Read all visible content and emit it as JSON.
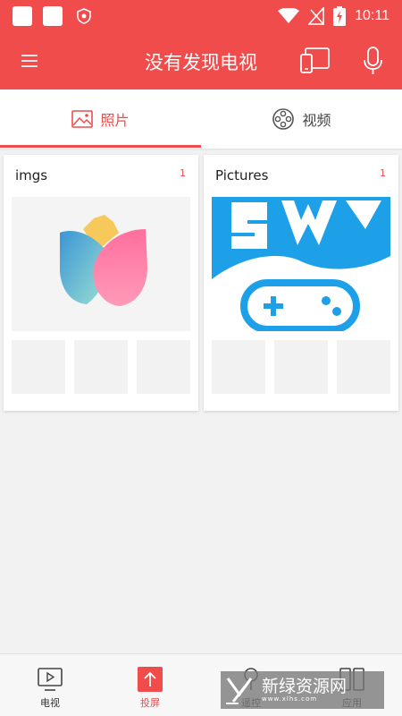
{
  "status_bar": {
    "time": "10:11",
    "icons": [
      "notification-square-icon",
      "notification-square-icon",
      "shield-icon",
      "wifi-icon",
      "no-signal-icon",
      "battery-charging-icon"
    ]
  },
  "app_bar": {
    "title": "没有发现电视",
    "icons": [
      "menu-icon",
      "tv-connect-icon",
      "microphone-icon"
    ]
  },
  "tabs": [
    {
      "label": "照片",
      "icon": "image-icon",
      "active": true
    },
    {
      "label": "视频",
      "icon": "film-reel-icon",
      "active": false
    }
  ],
  "albums": [
    {
      "name": "imgs",
      "count": "1",
      "cover": "tulip-logo"
    },
    {
      "name": "Pictures",
      "count": "1",
      "cover": "game-logo"
    }
  ],
  "bottom_nav": [
    {
      "label": "电视",
      "icon": "tv-play-icon"
    },
    {
      "label": "投屏",
      "icon": "cast-upload-icon",
      "active": true
    },
    {
      "label": "遥控",
      "icon": "remote-icon"
    },
    {
      "label": "应用",
      "icon": "apps-icon"
    }
  ],
  "watermark": {
    "text": "新绿资源网",
    "sub": "www.xlhs.com"
  },
  "colors": {
    "accent": "#f14c4c",
    "background": "#f2f2f2",
    "card": "#ffffff"
  }
}
